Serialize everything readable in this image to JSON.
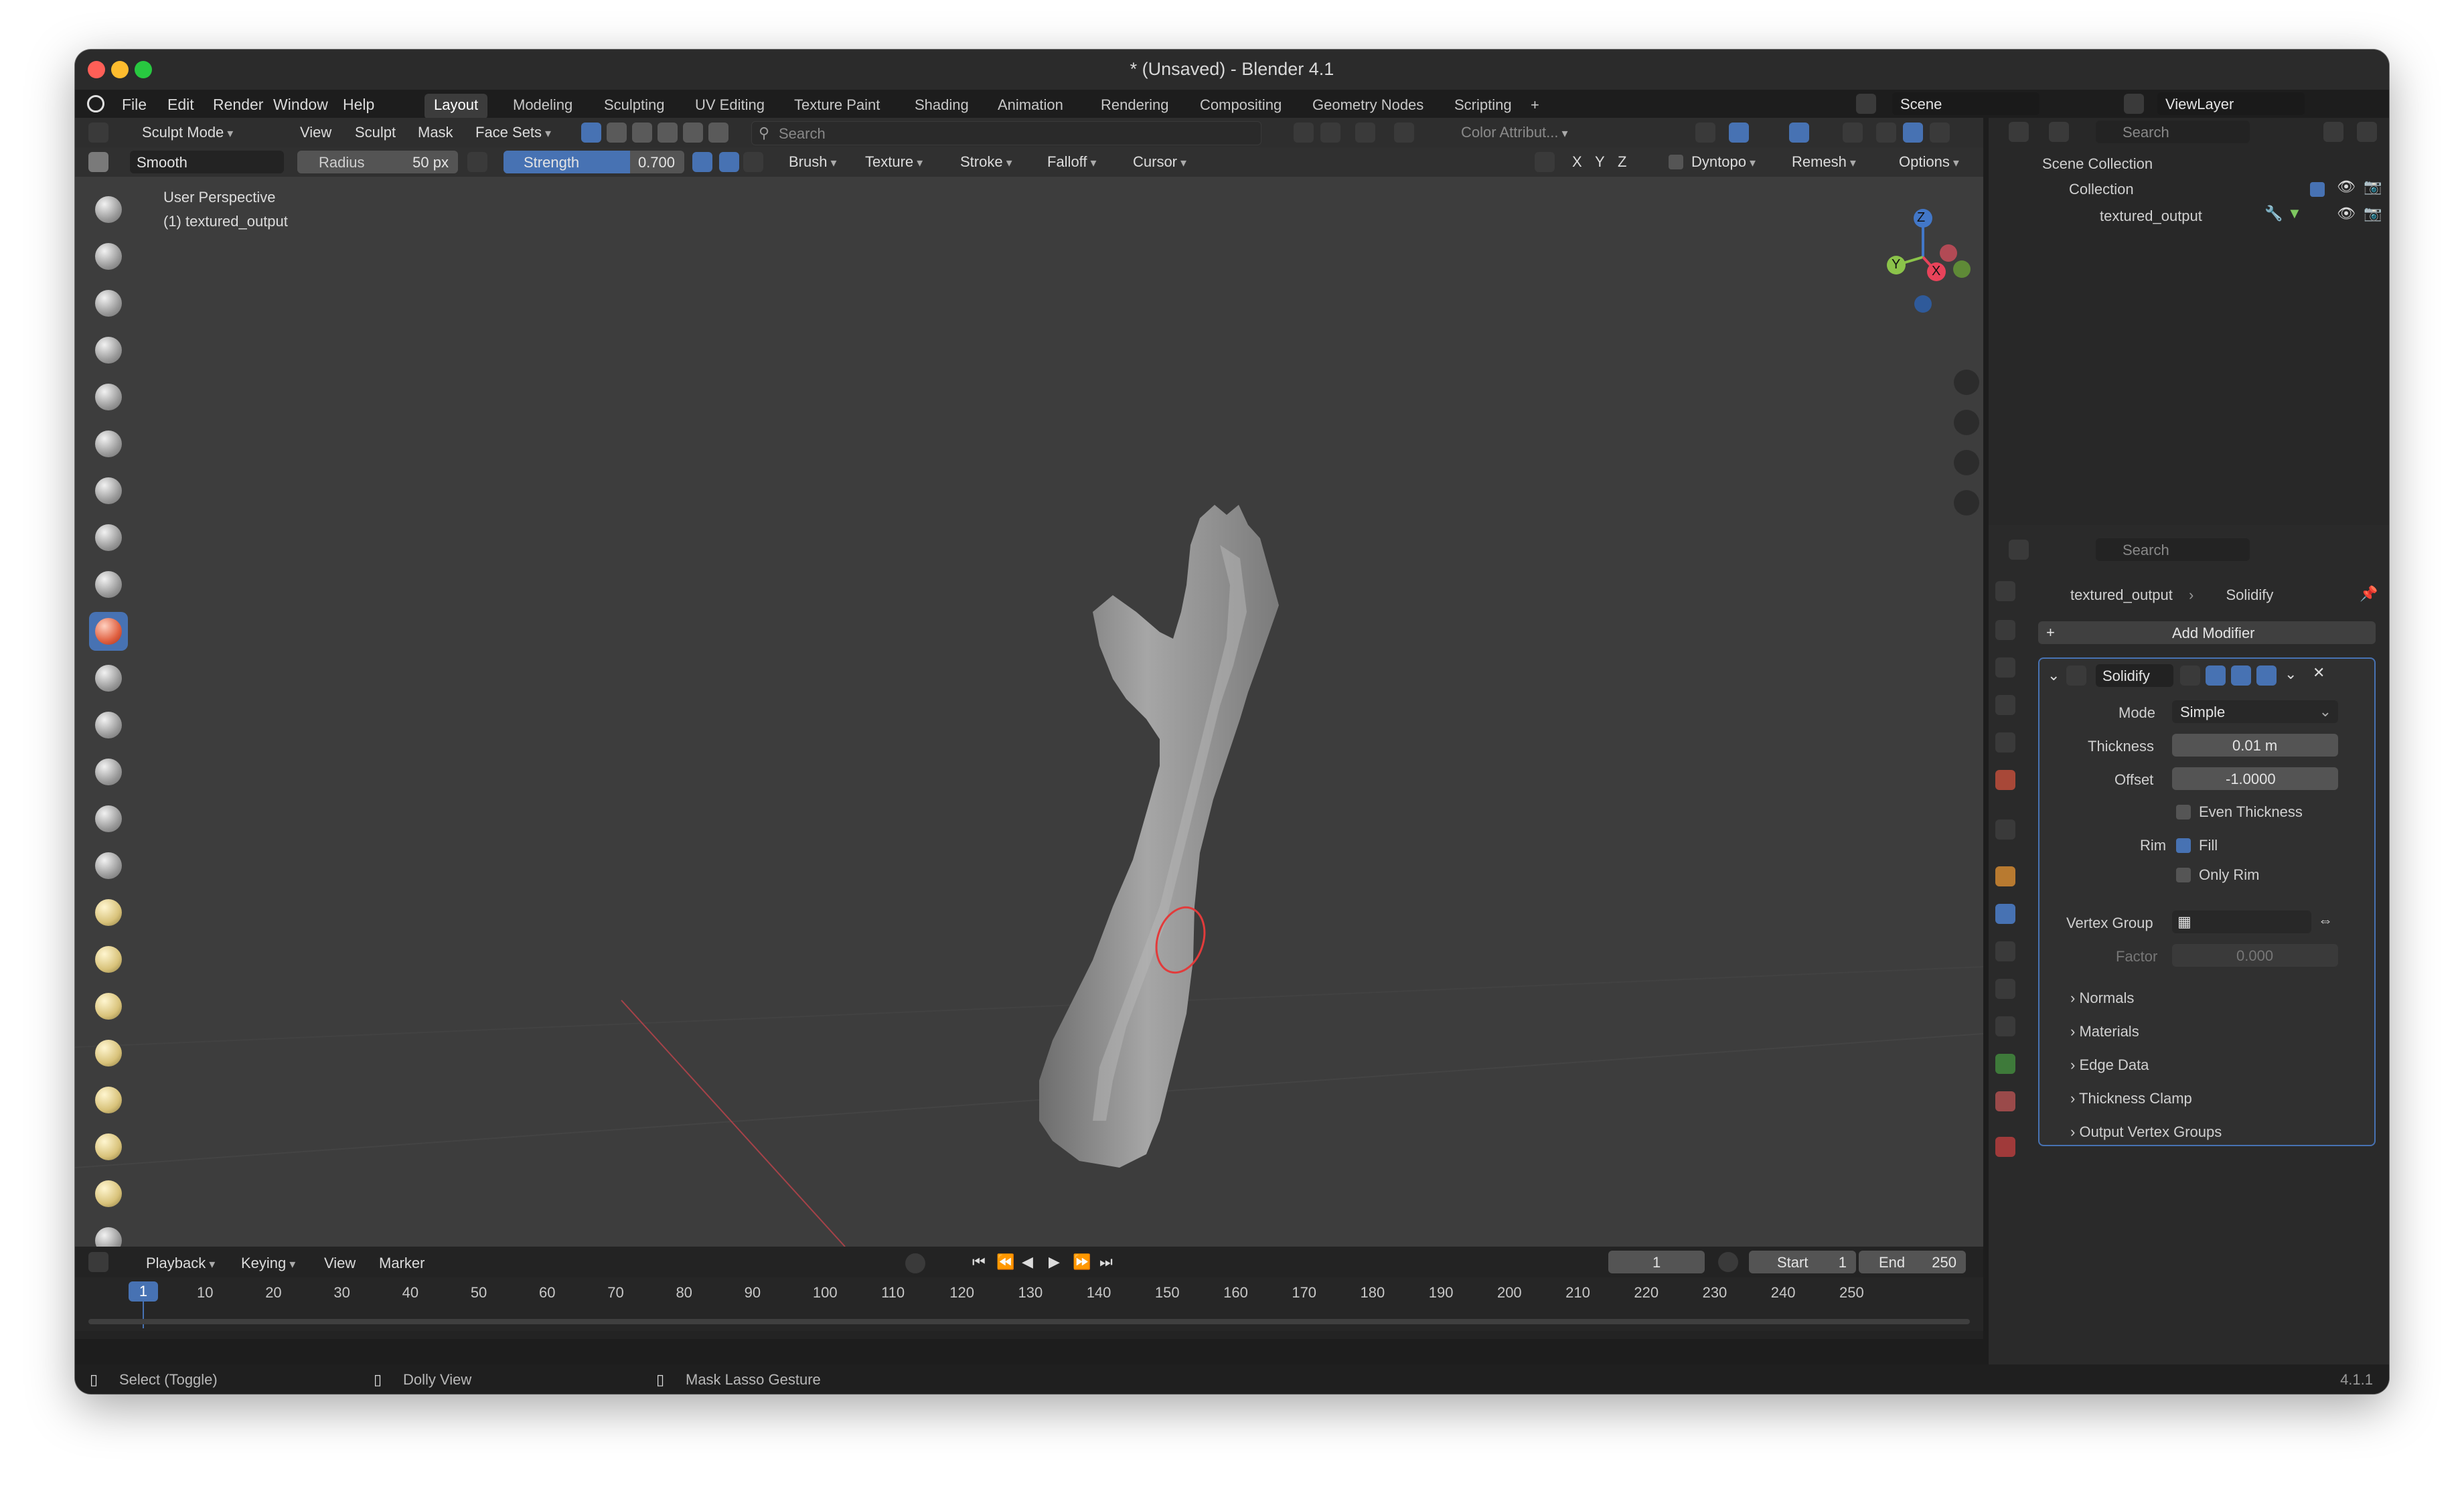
{
  "window": {
    "title": "* (Unsaved) - Blender 4.1"
  },
  "menu": [
    "File",
    "Edit",
    "Render",
    "Window",
    "Help"
  ],
  "workspaces": [
    "Layout",
    "Modeling",
    "Sculpting",
    "UV Editing",
    "Texture Paint",
    "Shading",
    "Animation",
    "Rendering",
    "Compositing",
    "Geometry Nodes",
    "Scripting",
    "+"
  ],
  "scene": {
    "name": "Scene",
    "view_layer": "ViewLayer"
  },
  "header": {
    "mode": "Sculpt Mode",
    "menus": [
      "View",
      "Sculpt",
      "Mask",
      "Face Sets"
    ],
    "search_placeholder": "Search",
    "color_attribute": "Color Attribut..."
  },
  "tool_settings": {
    "brush": "Smooth",
    "radius_label": "Radius",
    "radius_value": "50 px",
    "strength_label": "Strength",
    "strength_value": "0.700",
    "strength_fraction": 0.7,
    "dropdowns": [
      "Brush",
      "Texture",
      "Stroke",
      "Falloff",
      "Cursor"
    ],
    "axes": [
      "X",
      "Y",
      "Z"
    ],
    "dyntopo": "Dyntopo",
    "remesh": "Remesh",
    "options": "Options"
  },
  "viewport": {
    "perspective": "User Perspective",
    "object": "(1) textured_output"
  },
  "gizmo": {
    "z": "Z",
    "y": "Y",
    "x": "X"
  },
  "outliner": {
    "search_placeholder": "Search",
    "scene_collection": "Scene Collection",
    "collection": "Collection",
    "object": "textured_output"
  },
  "properties": {
    "search_placeholder": "Search",
    "breadcrumb_object": "textured_output",
    "breadcrumb_modifier": "Solidify",
    "add_modifier": "Add Modifier",
    "modifier_name": "Solidify",
    "mode_label": "Mode",
    "mode_value": "Simple",
    "thickness_label": "Thickness",
    "thickness_value": "0.01 m",
    "offset_label": "Offset",
    "offset_value": "-1.0000",
    "even_thickness": "Even Thickness",
    "rim_label": "Rim",
    "fill": "Fill",
    "only_rim": "Only Rim",
    "vertex_group_label": "Vertex Group",
    "factor_label": "Factor",
    "factor_value": "0.000",
    "panels": [
      "Normals",
      "Materials",
      "Edge Data",
      "Thickness Clamp",
      "Output Vertex Groups"
    ]
  },
  "timeline": {
    "menus": [
      "Playback",
      "Keying",
      "View",
      "Marker"
    ],
    "current_frame": "1",
    "start_label": "Start",
    "start_value": "1",
    "end_label": "End",
    "end_value": "250",
    "ticks": [
      "1",
      "10",
      "20",
      "30",
      "40",
      "50",
      "60",
      "70",
      "80",
      "90",
      "100",
      "110",
      "120",
      "130",
      "140",
      "150",
      "160",
      "170",
      "180",
      "190",
      "200",
      "210",
      "220",
      "230",
      "240",
      "250"
    ]
  },
  "statusbar": {
    "select": "Select (Toggle)",
    "dolly": "Dolly View",
    "mask": "Mask Lasso Gesture",
    "version": "4.1.1"
  },
  "colors": {
    "accent": "#4772b3",
    "axis_x": "#e8435a",
    "axis_y": "#8bc34a",
    "axis_z": "#4277c8"
  }
}
